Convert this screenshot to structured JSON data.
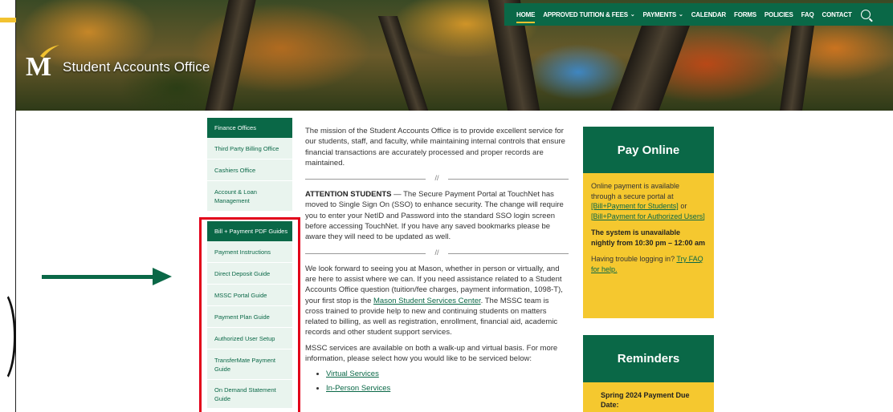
{
  "brand": {
    "accent_green": "#0a6847",
    "accent_gold": "#f5c82f",
    "highlight_red": "#e2001a"
  },
  "site": {
    "title": "Student Accounts Office",
    "logo_letter": "M"
  },
  "nav": {
    "items": [
      {
        "label": "HOME",
        "active": true,
        "dropdown": false
      },
      {
        "label": "APPROVED TUITION & FEES",
        "active": false,
        "dropdown": true
      },
      {
        "label": "PAYMENTS",
        "active": false,
        "dropdown": true
      },
      {
        "label": "CALENDAR",
        "active": false,
        "dropdown": false
      },
      {
        "label": "FORMS",
        "active": false,
        "dropdown": false
      },
      {
        "label": "POLICIES",
        "active": false,
        "dropdown": false
      },
      {
        "label": "FAQ",
        "active": false,
        "dropdown": false
      },
      {
        "label": "CONTACT",
        "active": false,
        "dropdown": false
      }
    ],
    "search_icon": "search-icon"
  },
  "sidebar": {
    "group1_heading": "Finance Offices",
    "group1": [
      {
        "label": "Third Party Billing Office"
      },
      {
        "label": "Cashiers Office"
      },
      {
        "label": "Account & Loan Management"
      }
    ],
    "group2_heading": "Bill + Payment PDF Guides",
    "group2": [
      {
        "label": "Payment Instructions"
      },
      {
        "label": "Direct Deposit Guide"
      },
      {
        "label": "MSSC Portal Guide"
      },
      {
        "label": "Payment Plan Guide"
      },
      {
        "label": "Authorized User Setup"
      },
      {
        "label": "TransferMate Payment Guide"
      },
      {
        "label": "On Demand Statement Guide"
      }
    ]
  },
  "main": {
    "mission": "The mission of the Student Accounts Office is to provide excellent service for our students, staff, and faculty, while maintaining internal controls that ensure financial transactions are accurately processed and proper records are maintained.",
    "divider_mark": "//",
    "attention_label": "ATTENTION STUDENTS",
    "attention_text": " — The Secure Payment Portal at TouchNet has moved to Single Sign On (SSO) to enhance security. The change will require you to enter your NetID and Password into the standard SSO login screen before accessing TouchNet. If you have any saved bookmarks please be aware they will need to be updated as well.",
    "welcome_before": "We look forward to seeing you at Mason, whether in person or virtually, and are here to assist where we can. If you need assistance related to a Student Accounts Office question (tuition/fee charges, payment information, 1098-T), your first stop is the ",
    "welcome_link": "Mason Student Services Center",
    "welcome_after": ". The MSSC team is cross trained to provide help to new and continuing students on matters related to billing, as well as registration, enrollment, financial aid, academic records and other student support services.",
    "services_text": "MSSC services are available on both a walk-up and virtual basis. For more information, please select how you would like to be serviced below:",
    "service_links": [
      "Virtual Services",
      "In-Person Services"
    ]
  },
  "pay_online": {
    "title": "Pay Online",
    "text_before": "Online payment is available through a secure portal at ",
    "link1": "[Bill+Payment for Students]",
    "text_mid": " or ",
    "link2": "[Bill+Payment for Authorized Users]",
    "unavailable": "The system is unavailable nightly from 10:30 pm – 12:00 am",
    "trouble_before": "Having trouble logging in? ",
    "trouble_link": "Try FAQ for help."
  },
  "reminders": {
    "title": "Reminders",
    "item1": "Spring 2024 Payment Due Date:"
  }
}
